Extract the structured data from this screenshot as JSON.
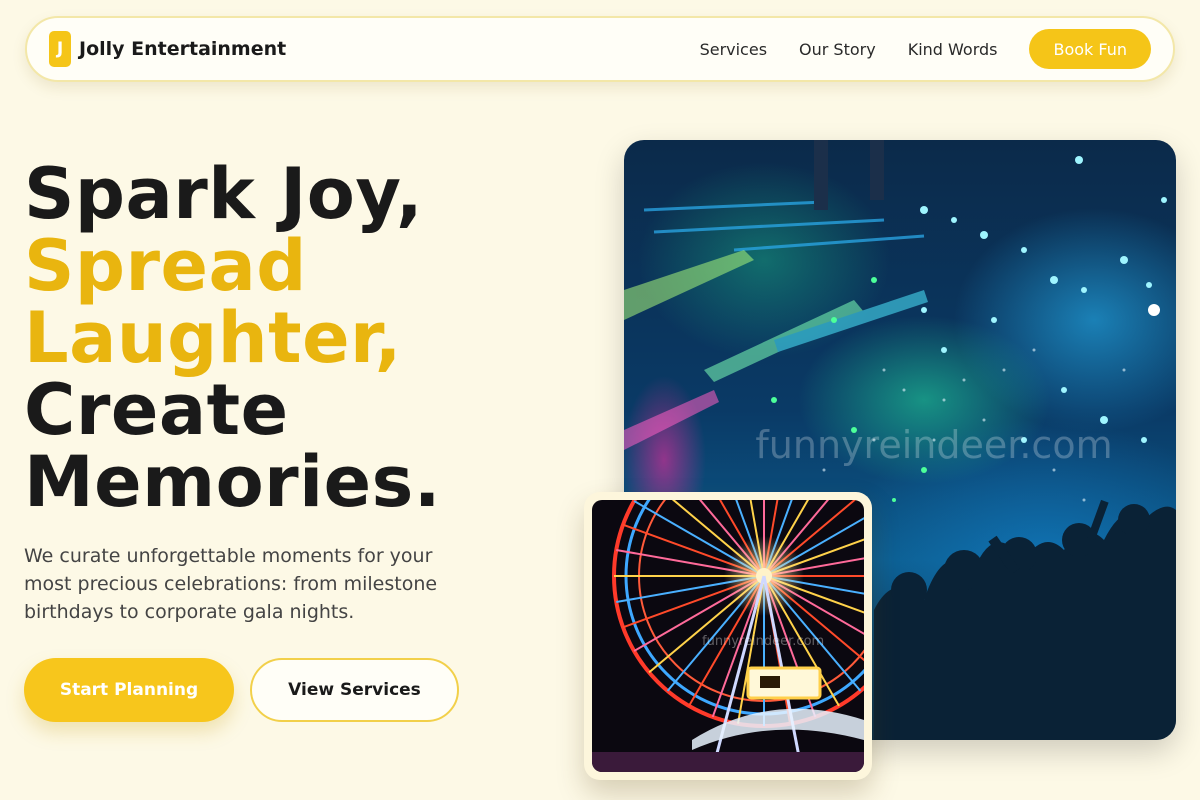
{
  "nav": {
    "logo_letter": "J",
    "brand_name": "Jolly Entertainment",
    "links": [
      "Services",
      "Our Story",
      "Kind Words"
    ],
    "cta_label": "Book Fun"
  },
  "hero": {
    "headline_line1": "Spark Joy,",
    "headline_line2": "Spread",
    "headline_line3": "Laughter,",
    "headline_line4": "Create",
    "headline_line5": "Memories.",
    "subtitle": "We curate unforgettable moments for your most precious celebrations: from milestone birthdays to corporate gala nights.",
    "primary_button": "Start Planning",
    "secondary_button": "View Services"
  },
  "images": {
    "main_watermark": "funnyreindeer.com",
    "card_watermark": "funnyreindeer.com"
  },
  "colors": {
    "accent": "#f5c518",
    "headline_accent": "#e9b50f",
    "background": "#fdf9e6"
  }
}
